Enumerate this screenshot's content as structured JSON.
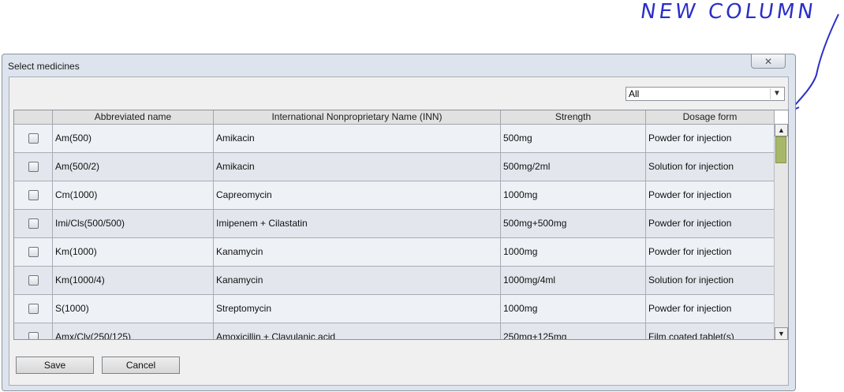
{
  "annotation": {
    "text": "NEW COLUMN"
  },
  "window": {
    "title": "Select medicines",
    "close_glyph": "✕"
  },
  "filter": {
    "selected": "All"
  },
  "table": {
    "columns": [
      "",
      "Abbreviated name",
      "International Nonproprietary Name (INN)",
      "Strength",
      "Dosage form"
    ],
    "rows": [
      {
        "abbr": "Am(500)",
        "inn": "Amikacin",
        "strength": "500mg",
        "form": "Powder for injection"
      },
      {
        "abbr": "Am(500/2)",
        "inn": "Amikacin",
        "strength": "500mg/2ml",
        "form": "Solution for injection"
      },
      {
        "abbr": "Cm(1000)",
        "inn": "Capreomycin",
        "strength": "1000mg",
        "form": "Powder for injection"
      },
      {
        "abbr": "Imi/Cls(500/500)",
        "inn": "Imipenem + Cilastatin",
        "strength": "500mg+500mg",
        "form": "Powder for injection"
      },
      {
        "abbr": "Km(1000)",
        "inn": "Kanamycin",
        "strength": "1000mg",
        "form": "Powder for injection"
      },
      {
        "abbr": "Km(1000/4)",
        "inn": "Kanamycin",
        "strength": "1000mg/4ml",
        "form": "Solution for injection"
      },
      {
        "abbr": "S(1000)",
        "inn": "Streptomycin",
        "strength": "1000mg",
        "form": "Powder for injection"
      },
      {
        "abbr": "Amx/Clv(250/125)",
        "inn": "Amoxicillin + Clavulanic acid",
        "strength": "250mg+125mg",
        "form": "Film coated tablet(s)"
      }
    ]
  },
  "buttons": {
    "save": "Save",
    "cancel": "Cancel"
  },
  "scrollbar": {
    "up_glyph": "▲",
    "down_glyph": "▼"
  },
  "colors": {
    "annotation": "#2a2fc8",
    "scroll_thumb": "#a7b86a"
  }
}
